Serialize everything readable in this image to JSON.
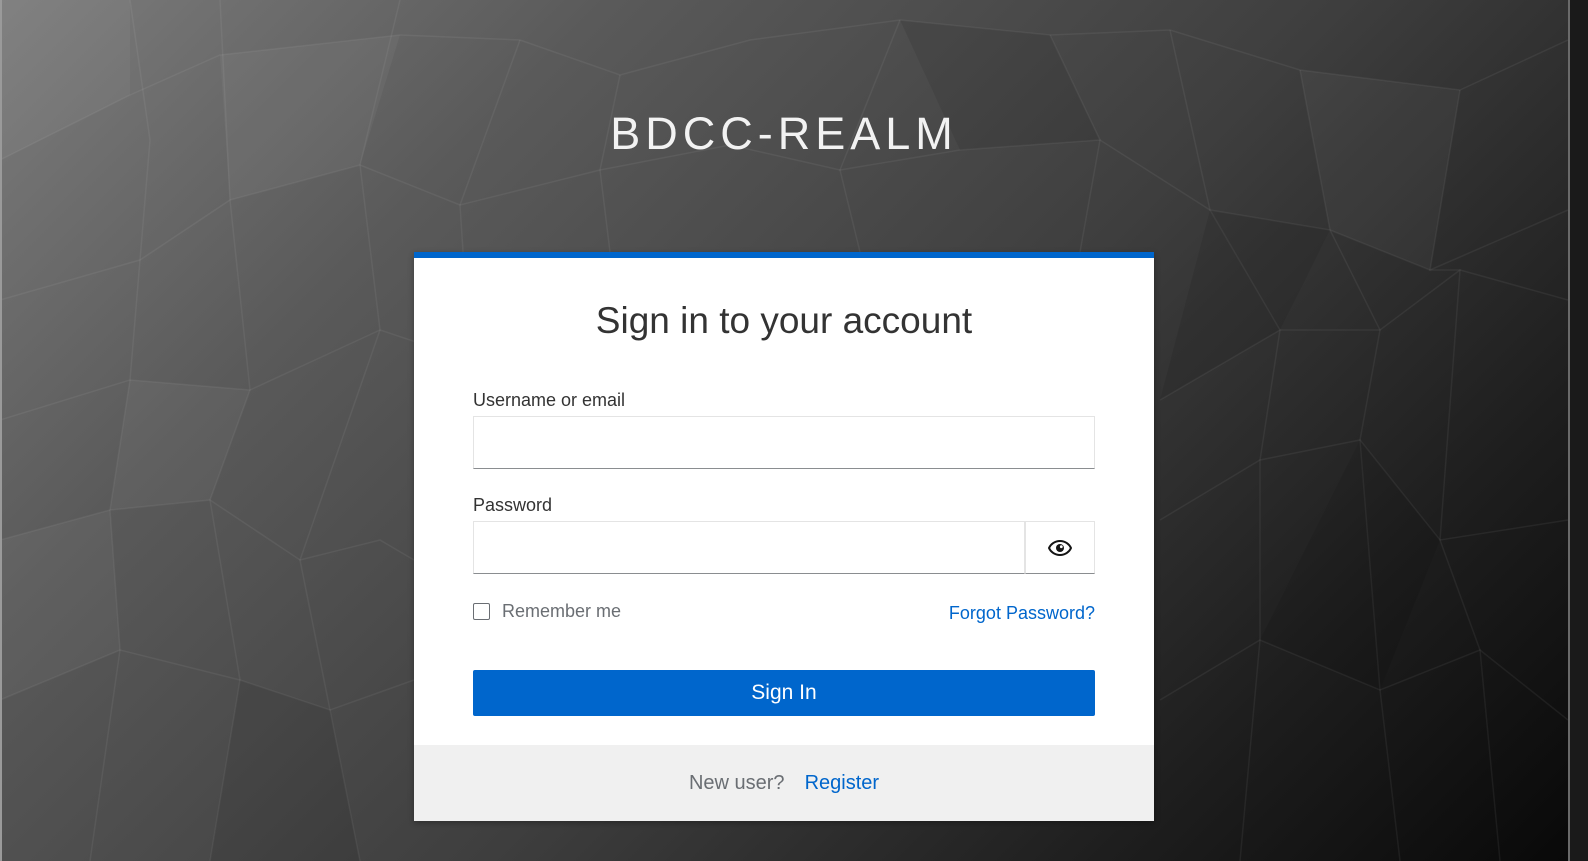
{
  "realm": {
    "title": "BDCC-REALM"
  },
  "login_card": {
    "heading": "Sign in to your account",
    "username": {
      "label": "Username or email",
      "value": "",
      "placeholder": ""
    },
    "password": {
      "label": "Password",
      "value": "",
      "placeholder": "",
      "toggle_icon": "eye-icon"
    },
    "remember_me": {
      "label": "Remember me",
      "checked": false
    },
    "forgot_password_label": "Forgot Password?",
    "sign_in_label": "Sign In",
    "footer": {
      "new_user_text": "New user?",
      "register_label": "Register"
    }
  },
  "colors": {
    "accent": "#0066cc",
    "card_background": "#ffffff",
    "footer_background": "#f0f0f0",
    "heading_text": "#333333",
    "muted_text": "#6a6e73"
  }
}
